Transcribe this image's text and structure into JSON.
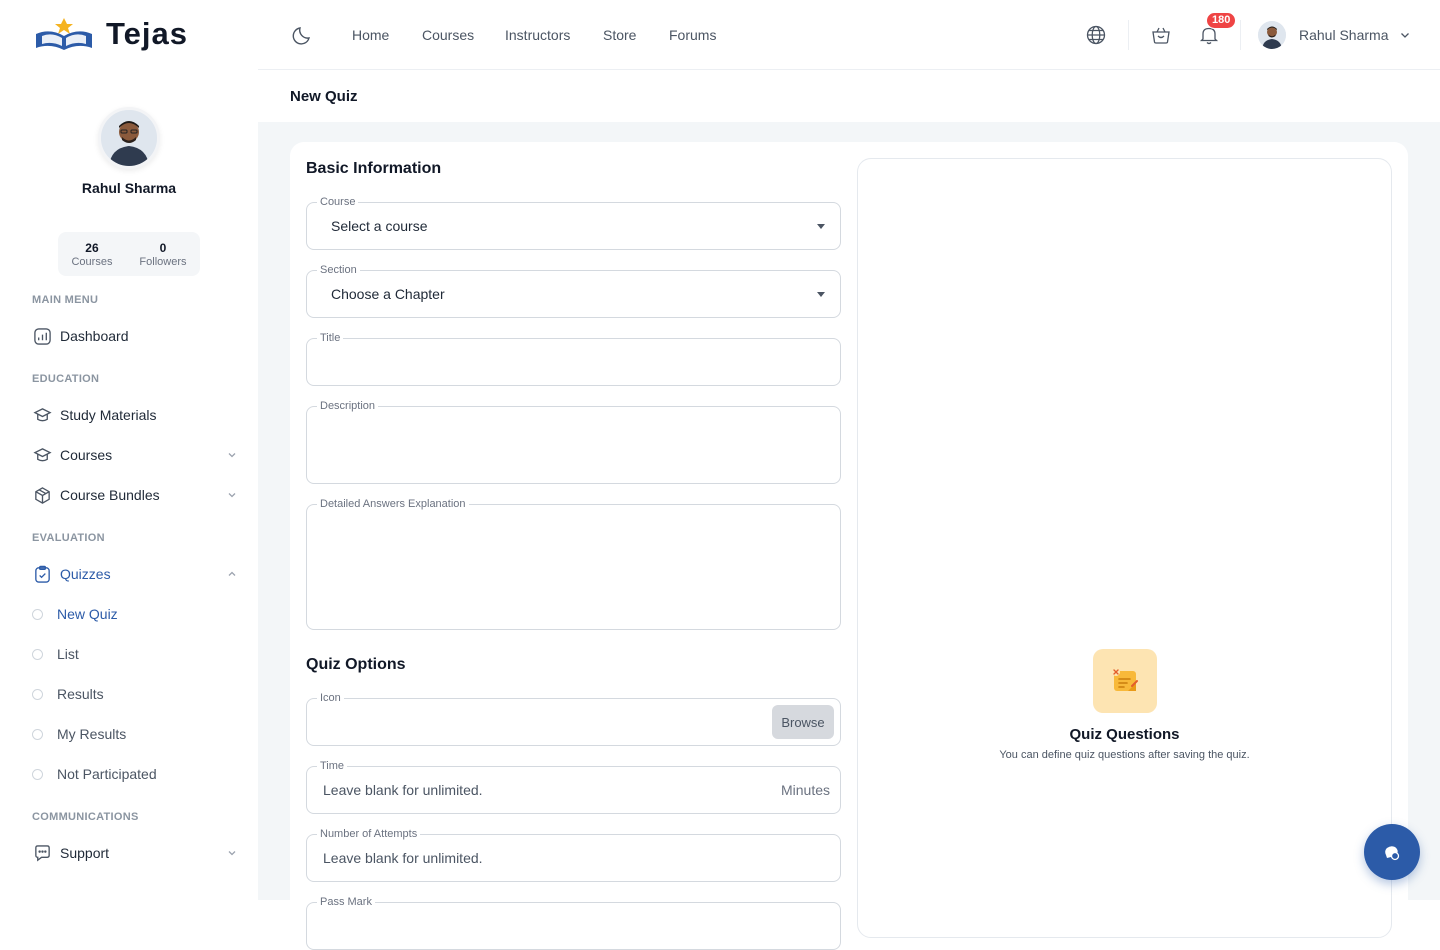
{
  "brand": {
    "name": "Tejas"
  },
  "user": {
    "name": "Rahul Sharma",
    "stats": [
      {
        "value": "26",
        "label": "Courses"
      },
      {
        "value": "0",
        "label": "Followers"
      }
    ]
  },
  "sidebar": {
    "headings": {
      "main": "MAIN MENU",
      "education": "EDUCATION",
      "evaluation": "EVALUATION",
      "communications": "COMMUNICATIONS"
    },
    "items": {
      "dashboard": "Dashboard",
      "study_materials": "Study Materials",
      "courses": "Courses",
      "course_bundles": "Course Bundles",
      "quizzes": "Quizzes",
      "support": "Support"
    },
    "quiz_sub_items": [
      "New Quiz",
      "List",
      "Results",
      "My Results",
      "Not Participated"
    ]
  },
  "topbar": {
    "nav": [
      "Home",
      "Courses",
      "Instructors",
      "Store",
      "Forums"
    ],
    "notification_count": "180",
    "user_name": "Rahul Sharma"
  },
  "page": {
    "title": "New Quiz"
  },
  "form": {
    "basic_title": "Basic Information",
    "course": {
      "label": "Course",
      "value": "Select a course"
    },
    "section": {
      "label": "Section",
      "value": "Choose a Chapter"
    },
    "title": {
      "label": "Title",
      "value": ""
    },
    "description": {
      "label": "Description",
      "value": ""
    },
    "explanation": {
      "label": "Detailed Answers Explanation",
      "value": ""
    },
    "options_title": "Quiz Options",
    "icon": {
      "label": "Icon",
      "button": "Browse"
    },
    "time": {
      "label": "Time",
      "placeholder": "Leave blank for unlimited.",
      "suffix": "Minutes"
    },
    "attempts": {
      "label": "Number of Attempts",
      "placeholder": "Leave blank for unlimited."
    },
    "pass_mark": {
      "label": "Pass Mark"
    }
  },
  "questions_panel": {
    "title": "Quiz Questions",
    "description": "You can define quiz questions after saving the quiz."
  },
  "colors": {
    "accent": "#2c5ba8",
    "badge": "#ef4444",
    "icon_bg": "#fde4b2",
    "content_bg": "#f3f6f8"
  }
}
